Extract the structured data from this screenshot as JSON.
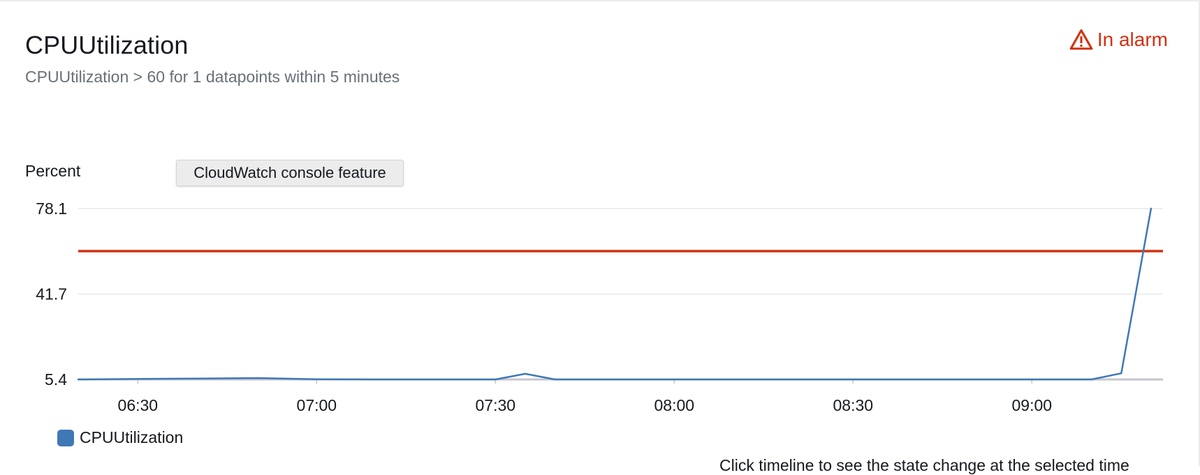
{
  "widget": {
    "title": "CPUUtilization",
    "subtitle": "CPUUtilization > 60 for 1 datapoints within 5 minutes",
    "status_label": "In alarm",
    "status_icon": "warning-triangle-icon",
    "status_color": "#d13212",
    "feature_button_label": "CloudWatch console feature",
    "footer_note": "Click timeline to see the state change at the selected time"
  },
  "chart_data": {
    "type": "line",
    "ylabel": "Percent",
    "ylim": [
      5.4,
      78.1
    ],
    "yticks": [
      "78.1",
      "41.7",
      "5.4"
    ],
    "xticks": [
      "06:30",
      "07:00",
      "07:30",
      "08:00",
      "08:30",
      "09:00"
    ],
    "xlim": [
      "06:20",
      "09:22"
    ],
    "grid": true,
    "legend_placement": "bottom-left",
    "threshold": {
      "value": 60,
      "color": "#d13212"
    },
    "series": [
      {
        "name": "CPUUtilization",
        "color": "#3f78b5",
        "points": [
          [
            "06:20",
            5.4
          ],
          [
            "06:30",
            5.6
          ],
          [
            "06:40",
            5.8
          ],
          [
            "06:50",
            6.0
          ],
          [
            "07:00",
            5.5
          ],
          [
            "07:10",
            5.4
          ],
          [
            "07:20",
            5.4
          ],
          [
            "07:30",
            5.4
          ],
          [
            "07:35",
            7.8
          ],
          [
            "07:40",
            5.4
          ],
          [
            "07:50",
            5.4
          ],
          [
            "08:00",
            5.4
          ],
          [
            "08:30",
            5.4
          ],
          [
            "09:00",
            5.4
          ],
          [
            "09:10",
            5.4
          ],
          [
            "09:15",
            8.0
          ],
          [
            "09:20",
            78.1
          ]
        ]
      }
    ]
  }
}
